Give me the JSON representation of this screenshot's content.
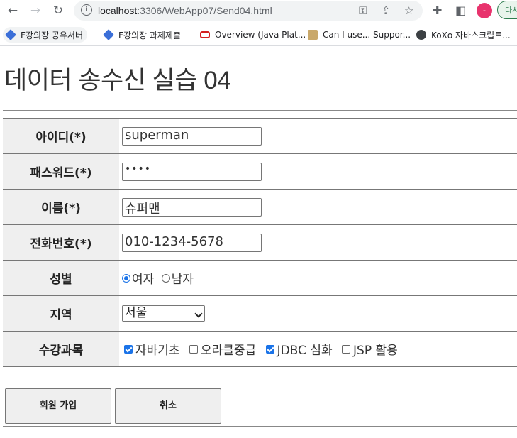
{
  "browser": {
    "url_host": "localhost",
    "url_rest": ":3306/WebApp07/Send04.html",
    "profile_initial": "-",
    "more_label": "다시",
    "bookmarks": [
      {
        "label": "F강의장 공유서버",
        "icon": "cube-icon"
      },
      {
        "label": "F강의장 과제제출",
        "icon": "cube-icon"
      },
      {
        "label": "Overview (Java Plat...",
        "icon": "oracle-icon"
      },
      {
        "label": "Can I use... Suppor...",
        "icon": "caniuse-icon"
      },
      {
        "label": "KoXo 자바스크립트...",
        "icon": "globe-icon"
      }
    ]
  },
  "page": {
    "title": "데이터 송수신 실습 04"
  },
  "form": {
    "id_label": "아이디(*)",
    "id_value": "superman",
    "pw_label": "패스워드(*)",
    "pw_value": "••••",
    "name_label": "이름(*)",
    "name_value": "슈퍼맨",
    "tel_label": "전화번호(*)",
    "tel_value": "010-1234-5678",
    "gender_label": "성별",
    "gender_options": [
      {
        "label": "여자",
        "checked": true
      },
      {
        "label": "남자",
        "checked": false
      }
    ],
    "region_label": "지역",
    "region_value": "서울",
    "subject_label": "수강과목",
    "subjects": [
      {
        "label": "자바기초",
        "checked": true
      },
      {
        "label": "오라클중급",
        "checked": false
      },
      {
        "label": "JDBC 심화",
        "checked": true
      },
      {
        "label": "JSP 활용",
        "checked": false
      }
    ]
  },
  "buttons": {
    "submit_label": "회원 가입",
    "cancel_label": "취소"
  },
  "colors": {
    "accent": "#1a73e8",
    "label_bg": "#efefef",
    "profile": "#e8336d"
  }
}
